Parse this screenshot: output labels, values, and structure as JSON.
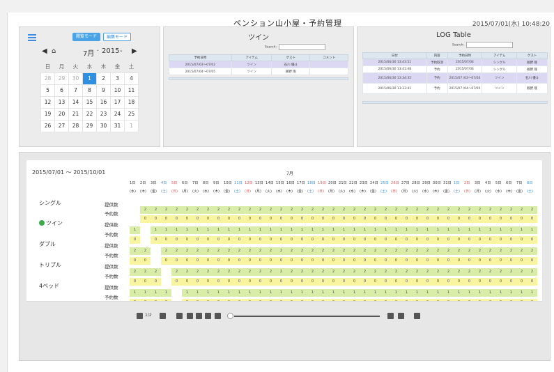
{
  "header": {
    "title": "ペンション山小屋・予約管理",
    "datetime": "2015/07/01(水) 10:48:20"
  },
  "calendar": {
    "mode_view": "閲覧モード",
    "mode_edit": "編集モード",
    "month": "7月",
    "year": "2015",
    "dow": [
      "日",
      "月",
      "火",
      "水",
      "木",
      "金",
      "土"
    ],
    "weeks": [
      [
        "28",
        "29",
        "30",
        "1",
        "2",
        "3",
        "4"
      ],
      [
        "5",
        "6",
        "7",
        "8",
        "9",
        "10",
        "11"
      ],
      [
        "12",
        "13",
        "14",
        "15",
        "16",
        "17",
        "18"
      ],
      [
        "19",
        "20",
        "21",
        "22",
        "23",
        "24",
        "25"
      ],
      [
        "26",
        "27",
        "28",
        "29",
        "30",
        "31",
        "1"
      ]
    ]
  },
  "twin_panel": {
    "title": "ツイン",
    "search_label": "Search:",
    "columns": [
      "予約日時",
      "アイテム",
      "ゲスト",
      "コメント"
    ],
    "rows": [
      [
        "2015/07/03〜07/02",
        "ツイン",
        "石川 優斗",
        ""
      ],
      [
        "2015/07/04〜07/05",
        "ツイン",
        "飯野 隆",
        ""
      ]
    ]
  },
  "log_panel": {
    "title": "LOG Table",
    "search_label": "Search:",
    "columns": [
      "日付",
      "内容",
      "予約日時",
      "アイテム",
      "ゲスト"
    ],
    "rows": [
      [
        "2015/06/30 13:43:51",
        "予約取消",
        "2015/07/04",
        "シングル",
        "飯野 隆"
      ],
      [
        "2015/06/30 13:41:48",
        "予約",
        "2015/07/04",
        "シングル",
        "飯野 隆"
      ],
      [
        "2015/06/30 13:34:35",
        "予約",
        "2015/07 /03〜07/03",
        "ツイン",
        "石川 優斗"
      ],
      [
        "2015/06/30 13:33:41",
        "予約",
        "2015/07 /04〜07/05",
        "ツイン",
        "飯野 隆"
      ]
    ]
  },
  "schedule": {
    "range": "2015/07/01 〜 2015/10/01",
    "month": "7月",
    "rooms": [
      {
        "name": "シングル",
        "supply_label": "提供数",
        "booked_label": "予約数",
        "supply_value": "2",
        "booked_value": "0"
      },
      {
        "name": "ツイン",
        "supply_label": "提供数",
        "booked_label": "予約数",
        "supply_value": "1",
        "booked_value": "0"
      },
      {
        "name": "ダブル",
        "supply_label": "提供数",
        "booked_label": "予約数",
        "supply_value": "2",
        "booked_value": "0"
      },
      {
        "name": "トリプル",
        "supply_label": "提供数",
        "booked_label": "予約数",
        "supply_value": "2",
        "booked_value": "0"
      },
      {
        "name": "4ベッド",
        "supply_label": "提供数",
        "booked_label": "予約数",
        "supply_value": "1",
        "booked_value": "0"
      }
    ]
  },
  "pager": {
    "page": "1/2"
  },
  "colors": {
    "supply": "#d9eca8",
    "booked": "#f8f4a0",
    "accent": "#3a8de0"
  }
}
